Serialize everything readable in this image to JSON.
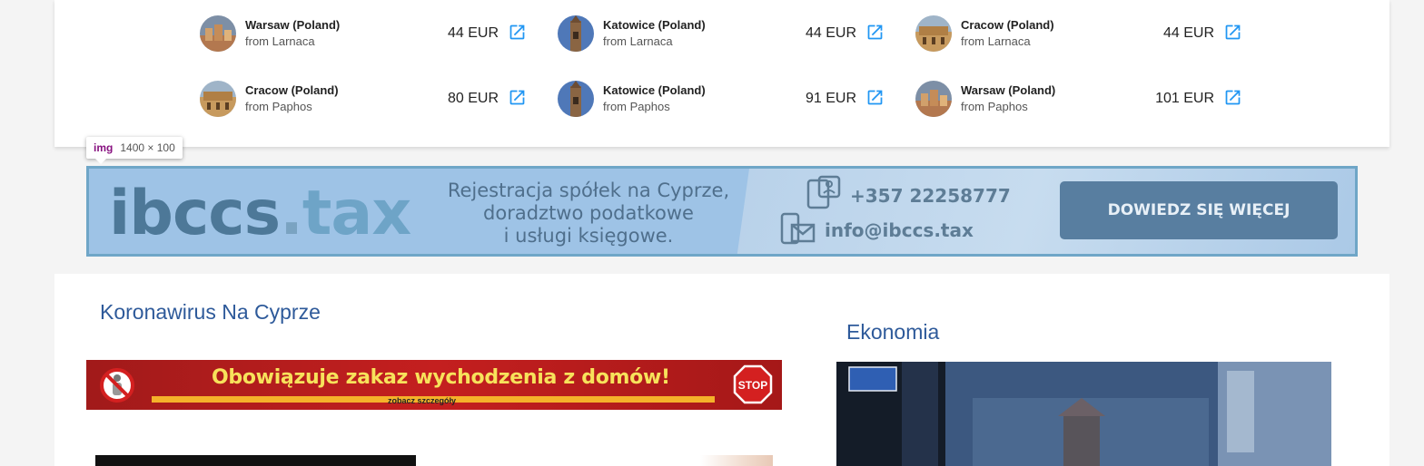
{
  "flights": [
    {
      "city": "Warsaw (Poland)",
      "from": "from Larnaca",
      "price": "44 EUR",
      "thumb": "warsaw-old-town"
    },
    {
      "city": "Katowice (Poland)",
      "from": "from Larnaca",
      "price": "44 EUR",
      "thumb": "katowice-church"
    },
    {
      "city": "Cracow (Poland)",
      "from": "from Larnaca",
      "price": "44 EUR",
      "thumb": "cracow-cloth-hall"
    },
    {
      "city": "Cracow (Poland)",
      "from": "from Paphos",
      "price": "80 EUR",
      "thumb": "cracow-cloth-hall"
    },
    {
      "city": "Katowice (Poland)",
      "from": "from Paphos",
      "price": "91 EUR",
      "thumb": "katowice-church"
    },
    {
      "city": "Warsaw (Poland)",
      "from": "from Paphos",
      "price": "101 EUR",
      "thumb": "warsaw-old-town"
    }
  ],
  "devtools_tooltip": {
    "tag": "img",
    "dims": "1400 × 100"
  },
  "ibccs": {
    "logo_main": "ibccs",
    "logo_dot": ".",
    "logo_tld": "tax",
    "tagline": [
      "Rejestracja spółek na Cyprze,",
      "doradztwo podatkowe",
      "i usługi księgowe."
    ],
    "phone": "+357 22258777",
    "email": "info@ibccs.tax",
    "cta": "DOWIEDZ SIĘ WIĘCEJ"
  },
  "sections": {
    "left_title": "Koronawirus Na Cyprze",
    "right_title": "Ekonomia"
  },
  "covid_banner": {
    "headline": "Obowiązuje zakaz wychodzenia z domów!",
    "sub": "zobacz szczegóły",
    "stop": "STOP"
  },
  "colors": {
    "accent_link": "#2196f3",
    "section_title": "#2e5a9a",
    "banner_red": "#c41f1f",
    "banner_yellow": "#f7e25b"
  }
}
